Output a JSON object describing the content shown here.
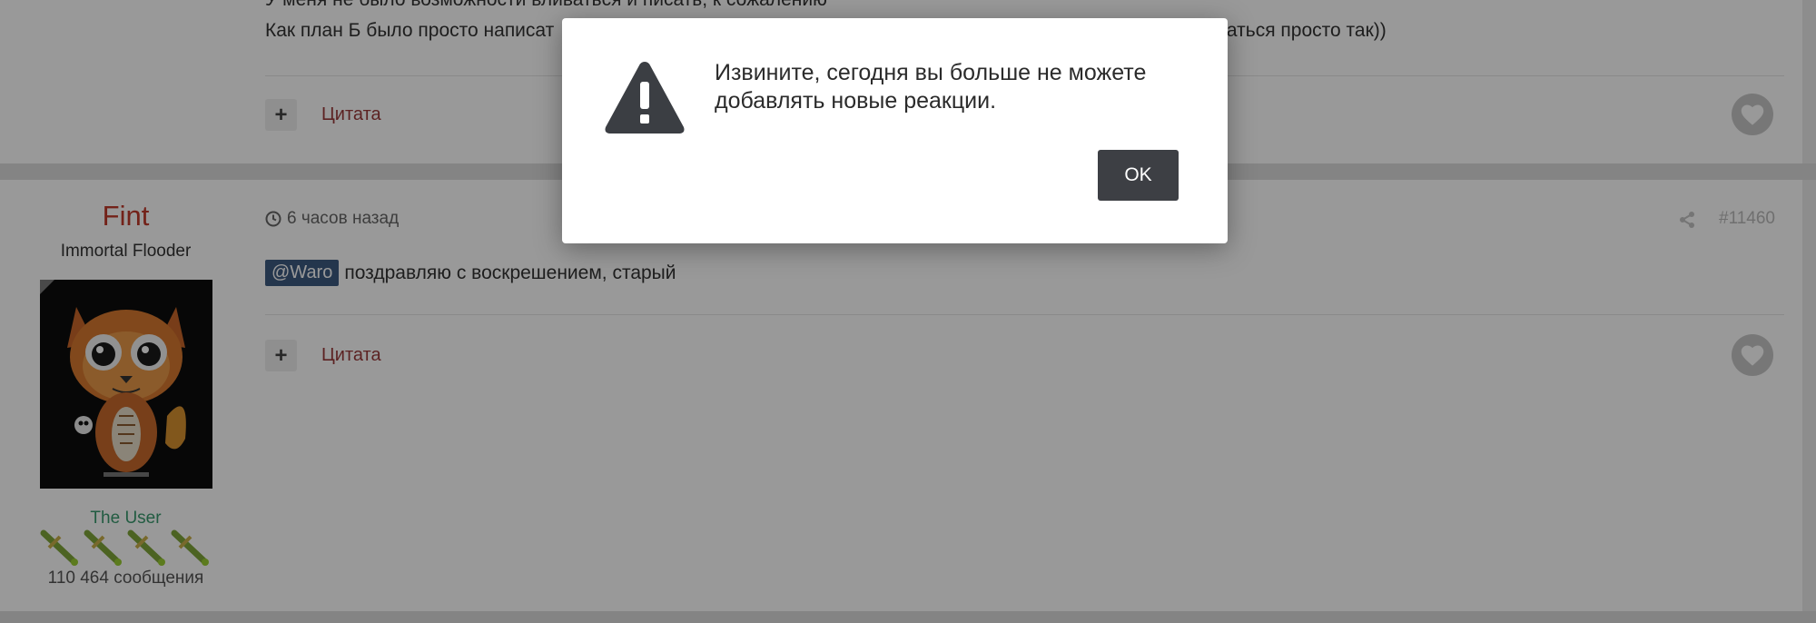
{
  "post_prev": {
    "line1": "У меня не было возможности вливаться и писать, к сожалению",
    "line2_left": "Как план Б было просто написат",
    "line2_right": "ваться просто так))",
    "quote_label": "Цитата"
  },
  "post": {
    "author": {
      "name": "Fint",
      "title": "Immortal Flooder",
      "group": "The User",
      "post_count": "110 464 сообщения"
    },
    "time": "6 часов назад",
    "number": "#11460",
    "mention": "@Waro",
    "body_text": "поздравляю с воскрешением, старый",
    "quote_label": "Цитата"
  },
  "modal": {
    "message": "Извините, сегодня вы больше не можете добавлять новые реакции.",
    "ok_label": "OK"
  },
  "icons": {
    "warning": "warning-triangle-icon",
    "clock": "clock-icon",
    "share": "share-icon",
    "heart": "heart-icon",
    "plus": "plus-icon"
  },
  "colors": {
    "author_name": "#c0392b",
    "quote_link": "#9a3a3a",
    "group": "#3a9a6e",
    "mention_bg": "#3d5a80",
    "ok_button": "#3d3f44"
  }
}
